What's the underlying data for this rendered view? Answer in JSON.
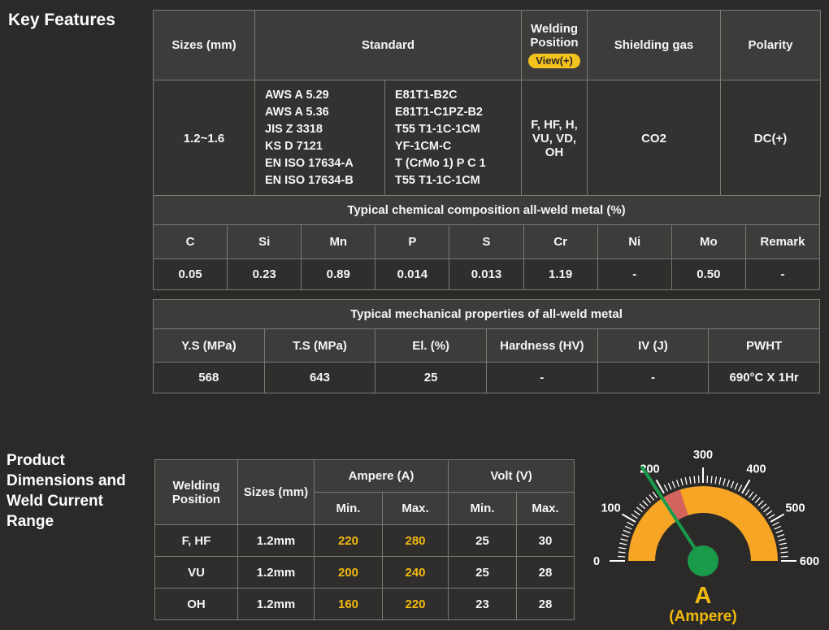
{
  "headings": {
    "key_features": "Key Features",
    "product_dimensions": "Product Dimensions and Weld Current Range"
  },
  "spec_table": {
    "headers": {
      "sizes": "Sizes (mm)",
      "standard": "Standard",
      "welding_position": "Welding Position",
      "view_button": "View(+)",
      "shielding_gas": "Shielding gas",
      "polarity": "Polarity"
    },
    "row": {
      "sizes": "1.2~1.6",
      "standards": [
        "AWS A 5.29",
        "AWS A 5.36",
        "JIS Z 3318",
        "KS D 7121",
        "EN ISO 17634-A",
        "EN ISO 17634-B"
      ],
      "classifications": [
        "E81T1-B2C",
        "E81T1-C1PZ-B2",
        "T55 T1-1C-1CM",
        "YF-1CM-C",
        "T (CrMo 1) P C 1",
        "T55 T1-1C-1CM"
      ],
      "welding_position": "F, HF, H, VU, VD, OH",
      "shielding_gas": "CO2",
      "polarity": "DC(+)"
    }
  },
  "chemical_table": {
    "title": "Typical chemical composition all-weld metal (%)",
    "columns": [
      "C",
      "Si",
      "Mn",
      "P",
      "S",
      "Cr",
      "Ni",
      "Mo",
      "Remark"
    ],
    "values": [
      "0.05",
      "0.23",
      "0.89",
      "0.014",
      "0.013",
      "1.19",
      "-",
      "0.50",
      "-"
    ]
  },
  "mechanical_table": {
    "title": "Typical mechanical properties of all-weld metal",
    "columns": [
      "Y.S (MPa)",
      "T.S (MPa)",
      "El. (%)",
      "Hardness (HV)",
      "IV (J)",
      "PWHT"
    ],
    "values": [
      "568",
      "643",
      "25",
      "-",
      "-",
      "690°C X 1Hr"
    ]
  },
  "current_table": {
    "headers": {
      "welding_position": "Welding Position",
      "sizes": "Sizes (mm)",
      "ampere": "Ampere (A)",
      "volt": "Volt (V)",
      "min": "Min.",
      "max": "Max."
    },
    "rows": [
      {
        "position": "F, HF",
        "size": "1.2mm",
        "amp_min": "220",
        "amp_max": "280",
        "volt_min": "25",
        "volt_max": "30"
      },
      {
        "position": "VU",
        "size": "1.2mm",
        "amp_min": "200",
        "amp_max": "240",
        "volt_min": "25",
        "volt_max": "28"
      },
      {
        "position": "OH",
        "size": "1.2mm",
        "amp_min": "160",
        "amp_max": "220",
        "volt_min": "23",
        "volt_max": "28"
      }
    ]
  },
  "chart_data": {
    "type": "gauge",
    "title": "A",
    "subtitle": "(Ampere)",
    "min": 0,
    "max": 600,
    "major_tick_step": 100,
    "minor_tick_step": 10,
    "tick_labels": [
      "0",
      "100",
      "200",
      "300",
      "400",
      "500",
      "600"
    ],
    "needle_value": 190,
    "highlight_range": [
      195,
      240
    ],
    "colors": {
      "band": "#F6A524",
      "highlight": "#D4635E",
      "needle": "#1A9B4C",
      "center": "#1A9B4C",
      "ticks": "#FFFFFF",
      "tick_text": "#FFFFFF",
      "caption": "#F2B90D"
    }
  }
}
